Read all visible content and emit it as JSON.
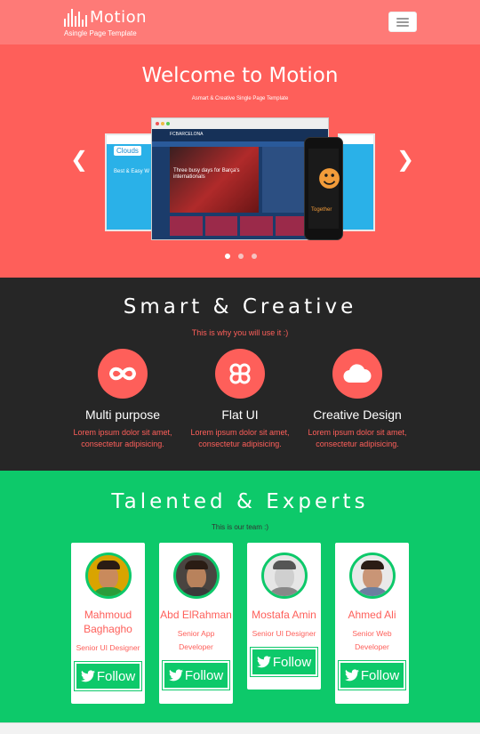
{
  "navbar": {
    "brand_name": "Motion",
    "brand_tagline": "Asingle Page Template",
    "menu_toggle": "menu-icon"
  },
  "hero": {
    "title": "Welcome to Motion",
    "subtitle": "Asmart & Creative Single Page Template",
    "slide_count": 3,
    "active_slide": 1,
    "mockup": {
      "left_screen_label": "Clouds",
      "left_screen_text": "Best & Easy W",
      "browser_brand": "FCBARCELONA",
      "browser_headline": "Three busy days for Barça's internationals",
      "phone_label": "Together"
    }
  },
  "smart": {
    "title": "Smart & Creative",
    "subtitle": "This is why you will use it :)",
    "features": [
      {
        "icon": "infinity-icon",
        "title": "Multi purpose",
        "desc_line1": "Lorem ipsum dolor sit amet,",
        "desc_line2": "consectetur adipisicing."
      },
      {
        "icon": "command-icon",
        "title": "Flat UI",
        "desc_line1": "Lorem ipsum dolor sit amet,",
        "desc_line2": "consectetur adipisicing."
      },
      {
        "icon": "cloud-icon",
        "title": "Creative Design",
        "desc_line1": "Lorem ipsum dolor sit amet,",
        "desc_line2": "consectetur adipisicing."
      }
    ]
  },
  "team": {
    "title": "Talented & Experts",
    "subtitle": "This is our team :)",
    "members": [
      {
        "name_line1": "Mahmoud",
        "name_line2": "Baghagho",
        "role_line1": "Senior UI Designer",
        "role_line2": "",
        "follow": "Follow"
      },
      {
        "name_line1": "Abd ElRahman",
        "name_line2": "",
        "role_line1": "Senior App",
        "role_line2": "Developer",
        "follow": "Follow"
      },
      {
        "name_line1": "Mostafa Amin",
        "name_line2": "",
        "role_line1": "Senior UI Designer",
        "role_line2": "",
        "follow": "Follow"
      },
      {
        "name_line1": "Ahmed Ali",
        "name_line2": "",
        "role_line1": "Senior Web",
        "role_line2": "Developer",
        "follow": "Follow"
      }
    ]
  },
  "colors": {
    "navbar": "#fe7a77",
    "hero": "#fe5f5a",
    "dark": "#262626",
    "accent": "#fe5f5a",
    "team_green": "#0dc96a"
  }
}
